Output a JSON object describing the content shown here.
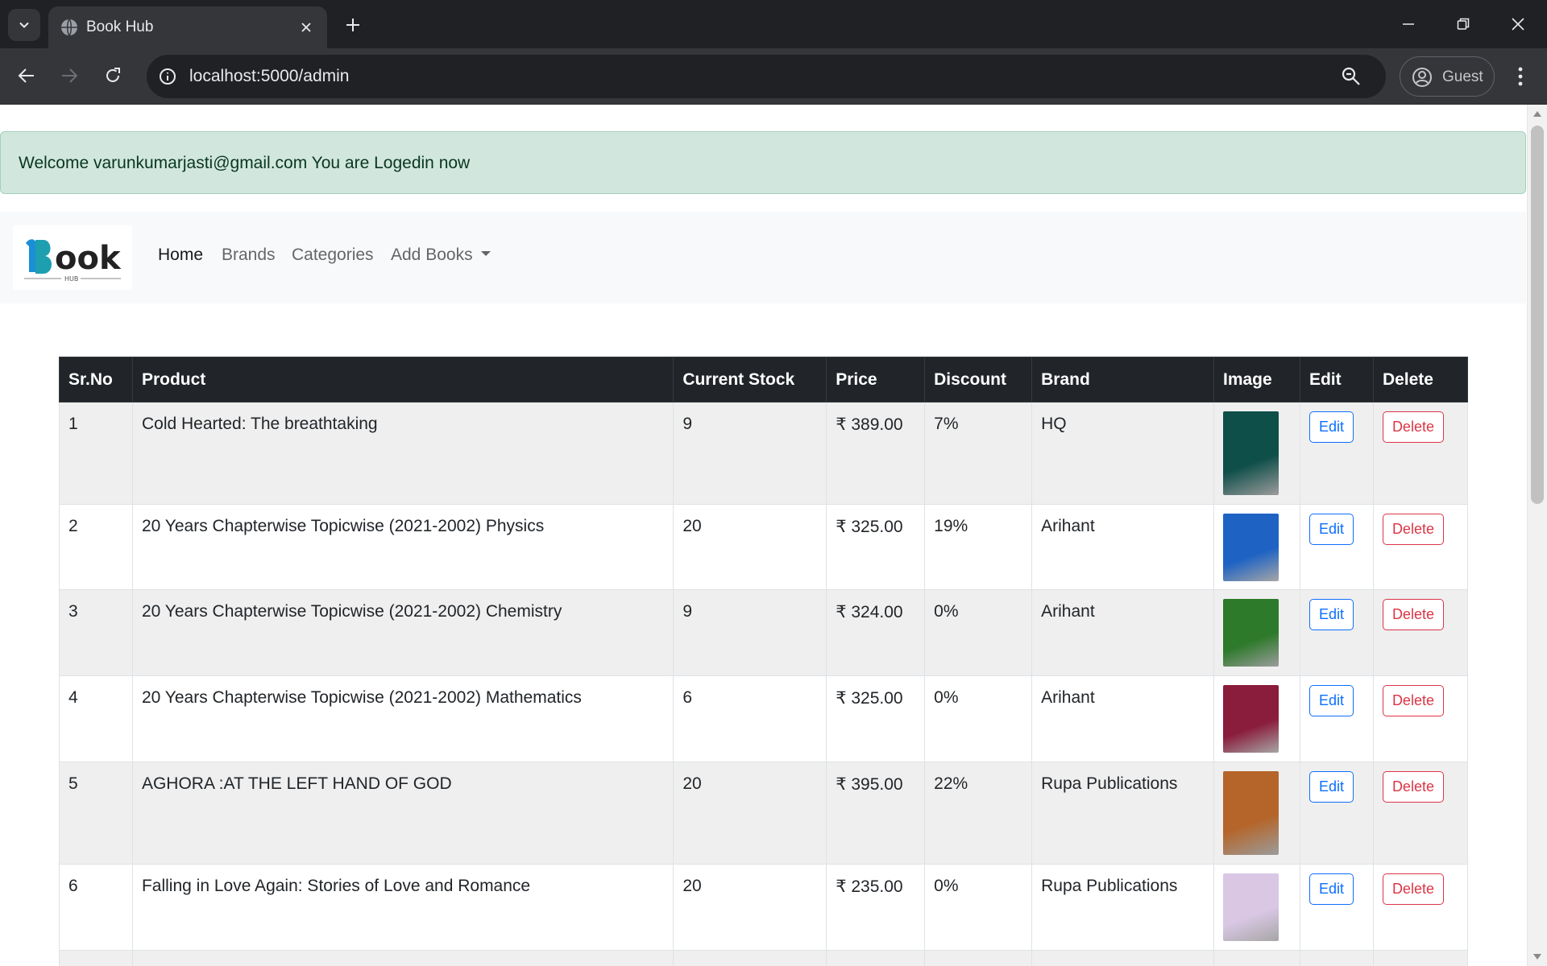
{
  "browser": {
    "tab_title": "Book Hub",
    "url": "localhost:5000/admin",
    "profile_label": "Guest"
  },
  "alert": {
    "message": "Welcome varunkumarjasti@gmail.com You are Logedin now"
  },
  "navbar": {
    "logo_text": "Book",
    "logo_subtext": "HUB",
    "links": [
      "Home",
      "Brands",
      "Categories",
      "Add Books"
    ]
  },
  "table": {
    "headers": [
      "Sr.No",
      "Product",
      "Current Stock",
      "Price",
      "Discount",
      "Brand",
      "Image",
      "Edit",
      "Delete"
    ],
    "rows": [
      {
        "sr": "1",
        "product": "Cold Hearted: The breathtaking",
        "stock": "9",
        "price": "₹ 389.00",
        "discount": "7%",
        "brand": "HQ",
        "cover_color": "#0f4f4a"
      },
      {
        "sr": "2",
        "product": "20 Years Chapterwise Topicwise (2021-2002) Physics",
        "stock": "20",
        "price": "₹ 325.00",
        "discount": "19%",
        "brand": "Arihant",
        "cover_color": "#1e63c4"
      },
      {
        "sr": "3",
        "product": "20 Years Chapterwise Topicwise (2021-2002) Chemistry",
        "stock": "9",
        "price": "₹ 324.00",
        "discount": "0%",
        "brand": "Arihant",
        "cover_color": "#2d7a2a"
      },
      {
        "sr": "4",
        "product": "20 Years Chapterwise Topicwise (2021-2002) Mathematics",
        "stock": "6",
        "price": "₹ 325.00",
        "discount": "0%",
        "brand": "Arihant",
        "cover_color": "#8a1c3c"
      },
      {
        "sr": "5",
        "product": "AGHORA :AT THE LEFT HAND OF GOD",
        "stock": "20",
        "price": "₹ 395.00",
        "discount": "22%",
        "brand": "Rupa Publications",
        "cover_color": "#b5652a"
      },
      {
        "sr": "6",
        "product": "Falling in Love Again: Stories of Love and Romance",
        "stock": "20",
        "price": "₹ 235.00",
        "discount": "0%",
        "brand": "Rupa Publications",
        "cover_color": "#d9c7e4"
      }
    ],
    "edit_label": "Edit",
    "delete_label": "Delete"
  }
}
